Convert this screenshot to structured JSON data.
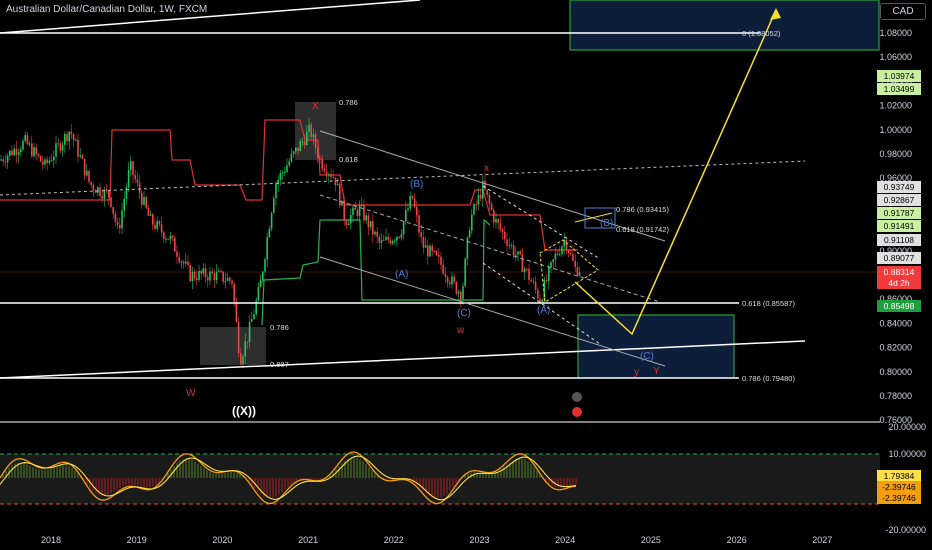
{
  "header": {
    "title": "Australian Dollar/Canadian Dollar, 1W, FXCM",
    "currency": "CAD"
  },
  "colors": {
    "up": "#26a69a",
    "bullish_candle": "#22c55e",
    "bearish_candle": "#ef4444",
    "supertrend_red": "#e03030",
    "supertrend_green": "#26b050",
    "projection": "#f5e02a",
    "zone_blue_fill": "#0d1e3b",
    "zone_blue_border": "#2f6fd0",
    "zone_green_border": "#2fbf2f",
    "osc_orange": "#f59e0b",
    "osc_yellow": "#fde047"
  },
  "chart_data": {
    "type": "candlestick",
    "symbol": "AUDCAD",
    "timeframe": "1W",
    "x_ticks": [
      "2018",
      "2019",
      "2020",
      "2021",
      "2022",
      "2023",
      "2024",
      "2025",
      "2026",
      "2027"
    ],
    "y_ticks": [
      "1.08000",
      "1.06000",
      "1.04000",
      "1.02000",
      "1.00000",
      "0.98000",
      "0.96000",
      "0.94000",
      "0.92000",
      "0.90000",
      "0.88000",
      "0.86000",
      "0.84000",
      "0.82000",
      "0.80000",
      "0.78000",
      "0.76000"
    ],
    "ylim": [
      0.755,
      1.1
    ],
    "price_tags": [
      {
        "label": "1.03974",
        "value": 1.03974,
        "bg": "#c8f0a0",
        "fg": "#000"
      },
      {
        "label": "1.03499",
        "value": 1.03499,
        "bg": "#c8f0a0",
        "fg": "#000"
      },
      {
        "label": "0.93749",
        "value": 0.93749,
        "bg": "#e0e0e0",
        "fg": "#000"
      },
      {
        "label": "0.92867",
        "value": 0.92867,
        "bg": "#e0e0e0",
        "fg": "#000"
      },
      {
        "label": "0.91787",
        "value": 0.91787,
        "bg": "#c8f0a0",
        "fg": "#000"
      },
      {
        "label": "0.91491",
        "value": 0.91491,
        "bg": "#c8f0a0",
        "fg": "#000"
      },
      {
        "label": "0.91108",
        "value": 0.91108,
        "bg": "#e0e0e0",
        "fg": "#000"
      },
      {
        "label": "0.89077",
        "value": 0.89077,
        "bg": "#e0e0e0",
        "fg": "#000"
      },
      {
        "label": "0.88314",
        "value": 0.88314,
        "bg": "#ef3b3b",
        "fg": "#fff"
      },
      {
        "label": "4d 2h",
        "value": 0.8745,
        "bg": "#ef3b3b",
        "fg": "#fff"
      },
      {
        "label": "0.85498",
        "value": 0.85498,
        "bg": "#1f9d3f",
        "fg": "#fff"
      }
    ],
    "fib_labels": [
      {
        "text": "0 (1.08052)",
        "value": 1.08052
      },
      {
        "text": "0.618 (0.85587)",
        "value": 0.85587
      },
      {
        "text": "0.786 (0.79480)",
        "value": 0.7948
      },
      {
        "text": "0.786 (0.93415)",
        "value": 0.93415
      },
      {
        "text": "0.618 (0.91742)",
        "value": 0.91742
      },
      {
        "text": "0.786",
        "value": 1.022
      },
      {
        "text": "0.618",
        "value": 0.978
      },
      {
        "text": "0.786",
        "value": 0.838
      },
      {
        "text": "0.887",
        "value": 0.809
      }
    ],
    "wave_labels": [
      {
        "text": "X",
        "color": "#e03030"
      },
      {
        "text": "x",
        "color": "#e03030"
      },
      {
        "text": "W",
        "color": "#e03030"
      },
      {
        "text": "w",
        "color": "#e03030"
      },
      {
        "text": "y",
        "color": "#e03030"
      },
      {
        "text": "Y",
        "color": "#e03030"
      },
      {
        "text": "((X))",
        "color": "#ffffff"
      },
      {
        "text": "(B)",
        "color": "#4f7fd6"
      },
      {
        "text": "(A)",
        "color": "#4f7fd6"
      },
      {
        "text": "(C)",
        "color": "#4f7fd6"
      },
      {
        "text": "(A)",
        "color": "#4f7fd6"
      },
      {
        "text": "(B)",
        "color": "#4f7fd6"
      },
      {
        "text": "(C)",
        "color": "#4f7fd6"
      }
    ],
    "oscillator": {
      "y_ticks": [
        "20.00000",
        "10.00000",
        "-20.00000"
      ],
      "ylim": [
        -20,
        20
      ],
      "price_tags": [
        {
          "label": "1.79384",
          "value": 1.79384,
          "bg": "#fde047",
          "fg": "#000"
        },
        {
          "label": "-2.39746",
          "value": -2.39746,
          "bg": "#f59e0b",
          "fg": "#000"
        },
        {
          "label": "-2.39746",
          "value": -4.6,
          "bg": "#f59e0b",
          "fg": "#000"
        }
      ]
    }
  }
}
